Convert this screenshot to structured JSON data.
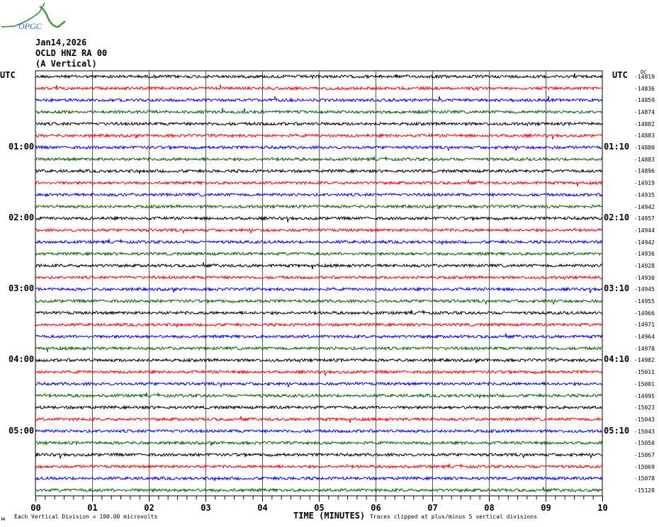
{
  "logo_text": "OPGC",
  "header": {
    "date": "Jan14,2026",
    "station": "OCLD HNZ RA 00",
    "component": "(A Vertical)"
  },
  "left_axis": {
    "title": "UTC",
    "labels": [
      "01:00",
      "02:00",
      "03:00",
      "04:00",
      "05:00"
    ]
  },
  "right_axis": {
    "title": "UTC",
    "dc_title": "DC",
    "labels": [
      "01:10",
      "02:10",
      "03:10",
      "04:10",
      "05:10"
    ]
  },
  "footer": {
    "scale_note": "Each Vertical Division =  100.00 microvolts",
    "xlabel": "TIME (MINUTES)",
    "clip_note": "Traces clipped at plus/minus 5 vertical divisions",
    "corner_mark": "м"
  },
  "chart_data": {
    "type": "line",
    "title": "Jan14,2026 OCLD HNZ RA 00 (A Vertical)",
    "xlabel": "TIME (MINUTES)",
    "ylabel": "UTC",
    "xlim": [
      0,
      10
    ],
    "x_ticks": [
      "00",
      "01",
      "02",
      "03",
      "04",
      "05",
      "06",
      "07",
      "08",
      "09",
      "10"
    ],
    "minutes_per_line": 10,
    "trace_colors": [
      "#000000",
      "#ff0000",
      "#0000ff",
      "#006400"
    ],
    "dc_offsets": [
      -14819,
      -14836,
      -14859,
      -14874,
      -14882,
      -14883,
      -14880,
      -14883,
      -14896,
      -14919,
      -14935,
      -14942,
      -14957,
      -14944,
      -14942,
      -14936,
      -14928,
      -14930,
      -14945,
      -14955,
      -14966,
      -14971,
      -14964,
      -14978,
      -14982,
      -15011,
      -15001,
      -14995,
      -15023,
      -15043,
      -15043,
      -15050,
      -15067,
      -15069,
      -15078,
      -15120
    ],
    "grid": true
  }
}
